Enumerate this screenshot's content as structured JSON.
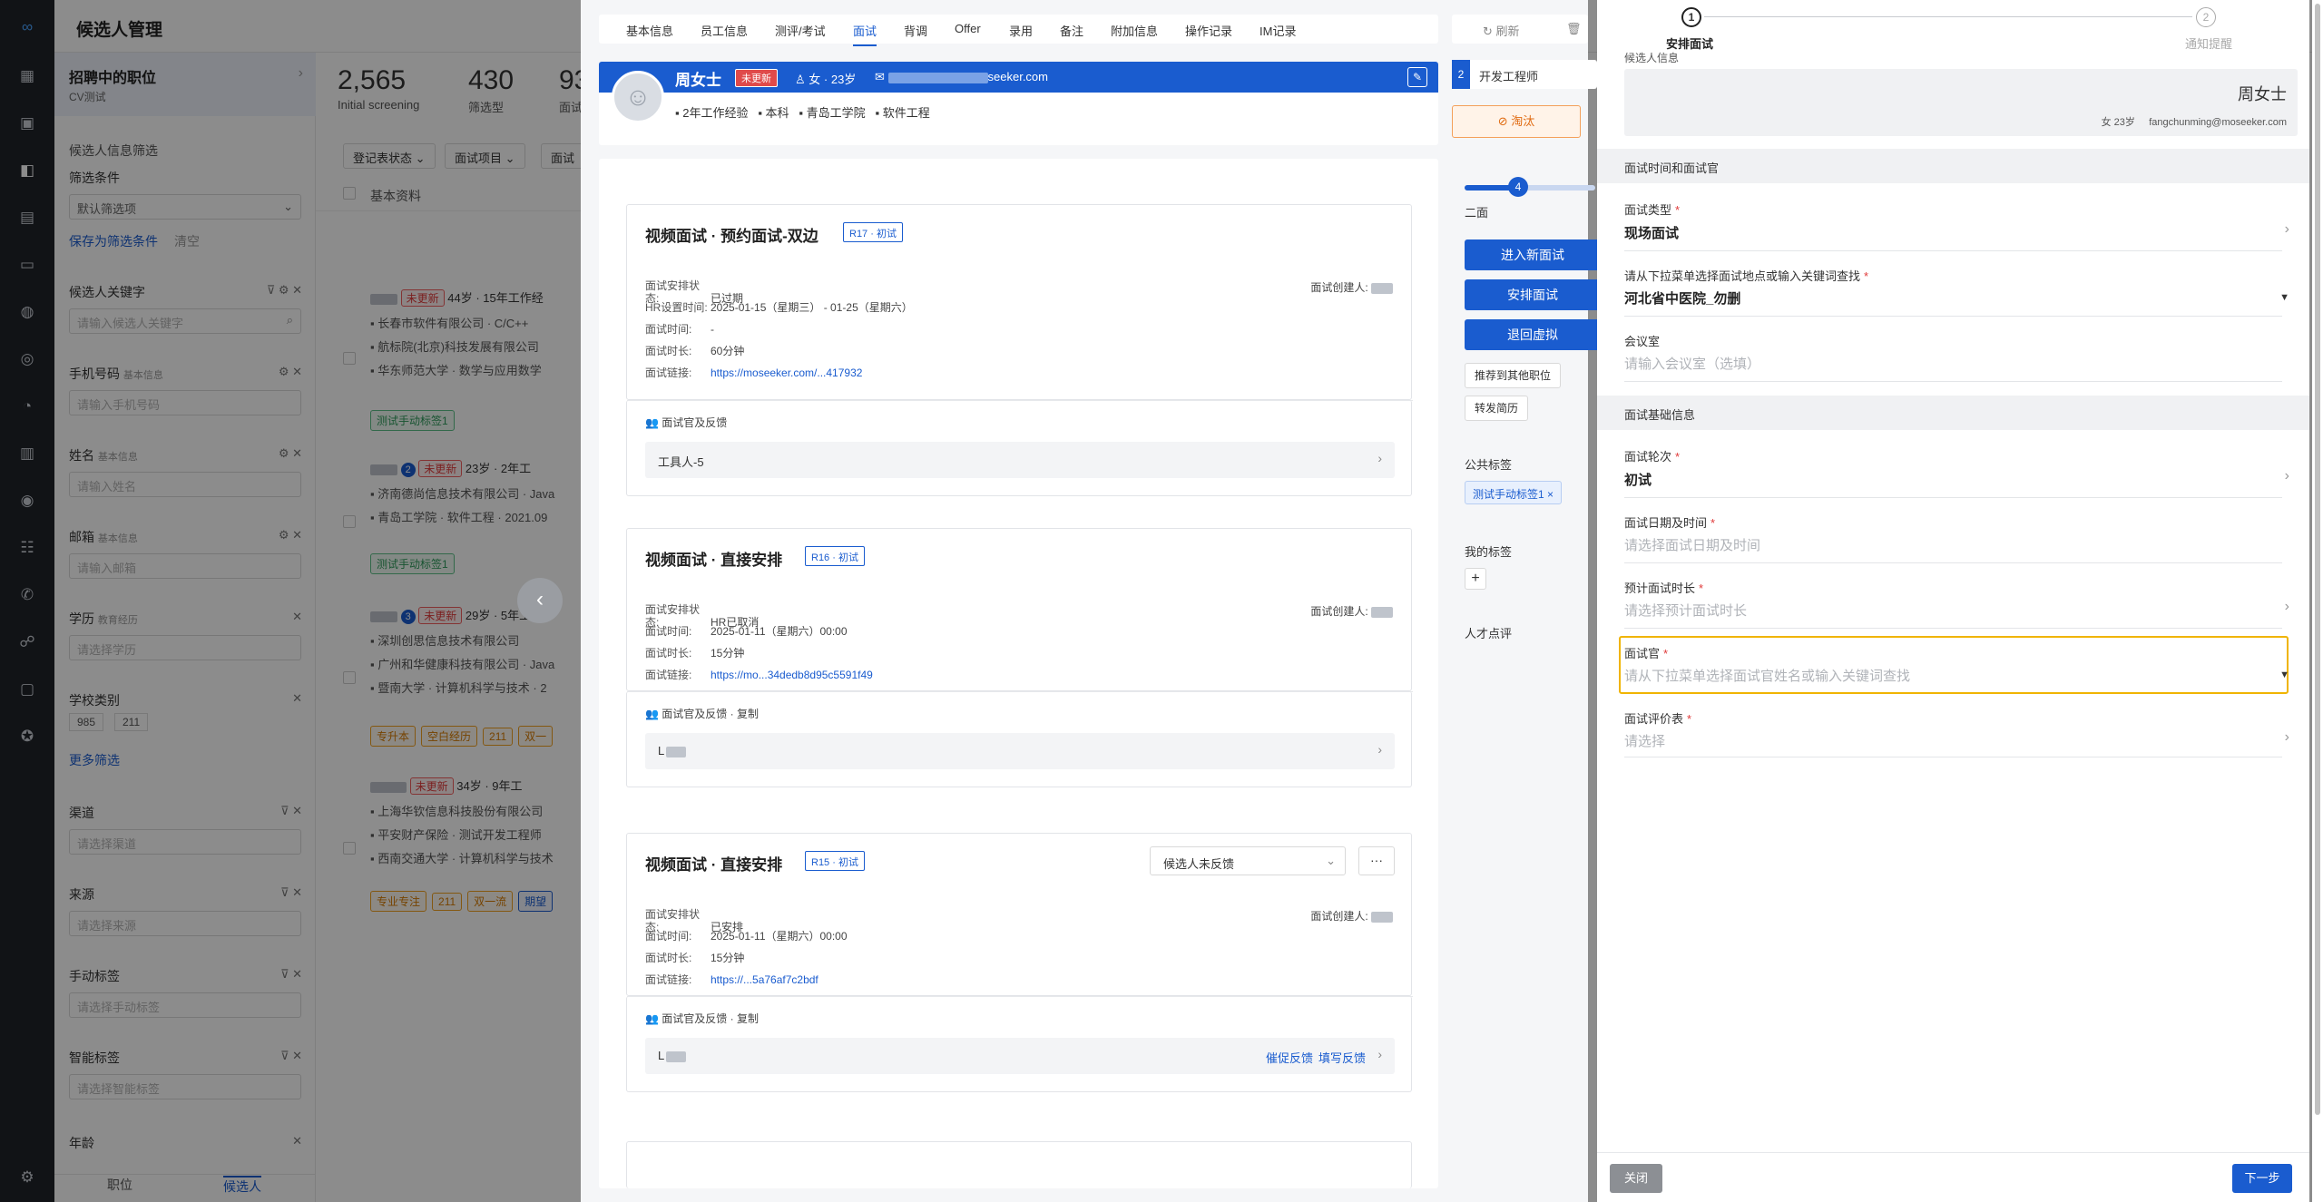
{
  "list": {
    "title": "候选人管理",
    "job_card": {
      "title": "招聘中的职位",
      "subtitle": "CV测试"
    },
    "filter": {
      "header": "候选人信息筛选",
      "cond_label": "筛选条件",
      "cond_default": "默认筛选项",
      "save_filter": "保存为筛选条件",
      "clear": "清空",
      "fields": [
        {
          "label": "候选人关键字",
          "sub": "",
          "placeholder": "请输入候选人关键字"
        },
        {
          "label": "手机号码",
          "sub": "基本信息",
          "placeholder": "请输入手机号码"
        },
        {
          "label": "姓名",
          "sub": "基本信息",
          "placeholder": "请输入姓名"
        },
        {
          "label": "邮箱",
          "sub": "基本信息",
          "placeholder": "请输入邮箱"
        },
        {
          "label": "学历",
          "sub": "教育经历",
          "placeholder": "请选择学历"
        }
      ],
      "school_label": "学校类别",
      "school_chips": [
        "985",
        "211"
      ],
      "more": "更多筛选",
      "fields2": [
        {
          "label": "渠道",
          "placeholder": "请选择渠道"
        },
        {
          "label": "来源",
          "placeholder": "请选择来源"
        },
        {
          "label": "手动标签",
          "placeholder": "请选择手动标签"
        },
        {
          "label": "智能标签",
          "placeholder": "请选择智能标签"
        }
      ],
      "age_label": "年龄",
      "bottom_tabs": [
        "职位",
        "候选人"
      ]
    },
    "stats": [
      {
        "value": "2,565",
        "label": "Initial screening"
      },
      {
        "value": "430",
        "label": "筛选型"
      },
      {
        "value": "93",
        "label": "面试"
      }
    ],
    "chips": [
      "登记表状态",
      "面试项目",
      "面试"
    ],
    "col_header": "基本资料",
    "candidates": [
      {
        "badge": "未更新",
        "meta": "44岁 · 15年工作经",
        "lines": [
          "长春市软件有限公司 · C/C++",
          "航标院(北京)科技发展有限公司",
          "华东师范大学 · 数学与应用数学"
        ],
        "tags": [
          "测试手动标签1"
        ]
      },
      {
        "num": "2",
        "badge": "未更新",
        "meta": "23岁 · 2年工",
        "lines": [
          "济南德尚信息技术有限公司 · Java",
          "青岛工学院 · 软件工程 · 2021.09"
        ],
        "tags": [
          "测试手动标签1"
        ]
      },
      {
        "num": "3",
        "badge": "未更新",
        "meta": "29岁 · 5年工",
        "lines": [
          "深圳创思信息技术有限公司",
          "广州和华健康科技有限公司 · Java",
          "暨南大学 · 计算机科学与技术 · 2"
        ],
        "tags": [
          "专升本",
          "空白经历",
          "211",
          "双一"
        ]
      },
      {
        "badge": "未更新",
        "meta": "34岁 · 9年工",
        "lines": [
          "上海华钦信息科技股份有限公司",
          "平安财产保险 · 测试开发工程师",
          "西南交通大学 · 计算机科学与技术"
        ],
        "tags": [
          "专业专注",
          "211",
          "双一流",
          "期望"
        ]
      }
    ]
  },
  "detail": {
    "tabs": [
      "基本信息",
      "员工信息",
      "测评/考试",
      "面试",
      "背调",
      "Offer",
      "录用",
      "备注",
      "附加信息",
      "操作记录",
      "IM记录"
    ],
    "active_tab": 3,
    "toolbar": {
      "refresh": "刷新",
      "delete": "删除"
    },
    "profile": {
      "name": "周女士",
      "status": "未更新",
      "gender_age": "女 · 23岁",
      "email_suffix": "seeker.com",
      "tags": [
        "2年工作经验",
        "本科",
        "青岛工学院",
        "软件工程"
      ]
    },
    "position": {
      "num": "2",
      "name": "开发工程师"
    },
    "eliminate": "淘汰",
    "stage": {
      "num": "4",
      "label": "二面"
    },
    "actions": [
      "进入新面试",
      "安排面试",
      "退回虚拟"
    ],
    "small_actions": [
      "推荐到其他职位",
      "转发简历"
    ],
    "public_tags_label": "公共标签",
    "public_tag": "测试手动标签1",
    "my_tags_label": "我的标签",
    "talent_review": "人才点评",
    "interviews": [
      {
        "title": "视频面试 · 预约面试-双边",
        "round": "R17 · 初试",
        "rows": [
          {
            "k": "面试安排状态:",
            "v": "已过期"
          },
          {
            "k": "HR设置时间:",
            "v": "2025-01-15（星期三） -  01-25（星期六）"
          },
          {
            "k": "面试时间:",
            "v": "-"
          },
          {
            "k": "面试时长:",
            "v": "60分钟"
          },
          {
            "k": "面试链接:",
            "v": "https://moseeker.com/...417932"
          }
        ],
        "creator": "面试创建人:",
        "feedback_label": "面试官及反馈",
        "feedback_person": "工具人-5",
        "feedback_actions": []
      },
      {
        "title": "视频面试 · 直接安排",
        "round": "R16 · 初试",
        "rows": [
          {
            "k": "面试安排状态:",
            "v": "HR已取消"
          },
          {
            "k": "面试时间:",
            "v": "2025-01-11（星期六）00:00"
          },
          {
            "k": "面试时长:",
            "v": "15分钟"
          },
          {
            "k": "面试链接:",
            "v": "https://mo...34dedb8d95c5591f49"
          }
        ],
        "creator": "面试创建人:",
        "feedback_label": "面试官及反馈 · 复制",
        "feedback_person": "L",
        "feedback_actions": []
      },
      {
        "title": "视频面试 · 直接安排",
        "round": "R15 · 初试",
        "select": "候选人未反馈",
        "rows": [
          {
            "k": "面试安排状态:",
            "v": "已安排"
          },
          {
            "k": "面试时间:",
            "v": "2025-01-11（星期六）00:00"
          },
          {
            "k": "面试时长:",
            "v": "15分钟"
          },
          {
            "k": "面试链接:",
            "v": "https://...5a76af7c2bdf"
          }
        ],
        "creator": "面试创建人:",
        "feedback_label": "面试官及反馈 · 复制",
        "feedback_person": "L",
        "feedback_actions": [
          "催促反馈",
          "填写反馈"
        ]
      }
    ]
  },
  "drawer": {
    "steps": [
      {
        "num": "1",
        "label": "安排面试",
        "active": true
      },
      {
        "num": "2",
        "label": "通知提醒",
        "active": false
      }
    ],
    "candidate_info_label": "候选人信息",
    "candidate": {
      "name": "周女士",
      "gender_age": "女 23岁",
      "email": "fangchunming@moseeker.com"
    },
    "section1": "面试时间和面试官",
    "section2": "面试基础信息",
    "fields": {
      "type": {
        "label": "面试类型",
        "value": "现场面试"
      },
      "location": {
        "label": "请从下拉菜单选择面试地点或输入关键词查找",
        "value": "河北省中医院_勿删"
      },
      "room": {
        "label": "会议室",
        "placeholder": "请输入会议室（选填）"
      },
      "round": {
        "label": "面试轮次",
        "value": "初试"
      },
      "datetime": {
        "label": "面试日期及时间",
        "placeholder": "请选择面试日期及时间"
      },
      "duration": {
        "label": "预计面试时长",
        "placeholder": "请选择预计面试时长"
      },
      "interviewer": {
        "label": "面试官",
        "placeholder": "请从下拉菜单选择面试官姓名或输入关键词查找"
      },
      "form": {
        "label": "面试评价表",
        "placeholder": "请选择"
      }
    },
    "close": "关闭",
    "next": "下一步"
  },
  "colors": {
    "primary": "#1a5ccf",
    "focus": "#f0b400",
    "danger": "#e03a3a"
  }
}
